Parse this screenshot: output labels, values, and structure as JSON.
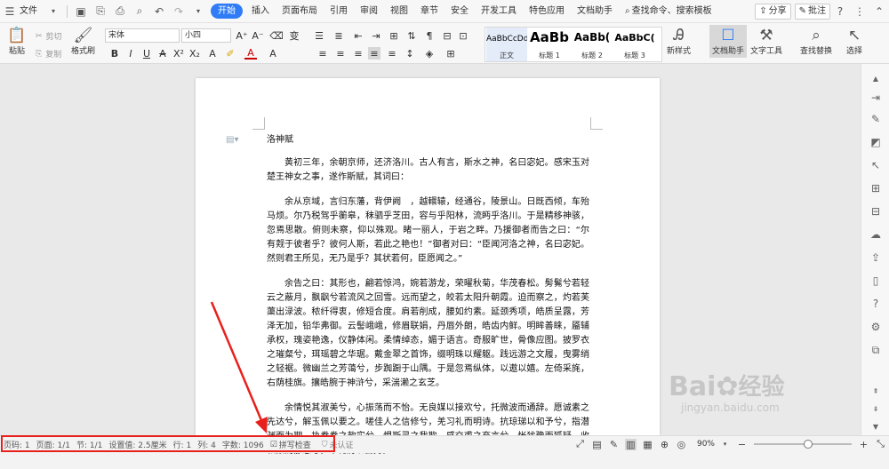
{
  "menubar": {
    "items": [
      "文件",
      "开始",
      "插入",
      "页面布局",
      "引用",
      "审阅",
      "视图",
      "章节",
      "安全",
      "开发工具",
      "特色应用",
      "文档助手"
    ],
    "active": "开始",
    "search_label": "查找命令、搜索模板",
    "share_label": "分享",
    "comment_label": "批注",
    "help_label": "?"
  },
  "ribbon": {
    "paste_label": "粘贴",
    "cut_label": "剪切",
    "copy_label": "复制",
    "format_painter_label": "格式刷",
    "font_name": "宋体",
    "font_size": "小四",
    "styles": [
      {
        "preview": "AaBbCcDd",
        "label": "正文"
      },
      {
        "preview": "AaBb",
        "label": "标题 1"
      },
      {
        "preview": "AaBb(",
        "label": "标题 2"
      },
      {
        "preview": "AaBbC(",
        "label": "标题 3"
      }
    ],
    "new_style_label": "新样式",
    "doc_assistant_label": "文档助手",
    "text_tools_label": "文字工具",
    "find_replace_label": "查找替换",
    "select_label": "选择"
  },
  "document": {
    "title": "洛神赋",
    "paragraphs": [
      "黄初三年，余朝京师，还济洛川。古人有言，斯水之神，名曰宓妃。感宋玉对楚王神女之事，遂作斯赋，其词曰：",
      "余从京域，言归东藩，背伊阙　，越轘辕，经通谷，陵景山。日既西倾，车殆马烦。尔乃税驾乎蘅皋，秣驷乎芝田，容与乎阳林，流眄乎洛川。于是精移神骇，忽焉思散。俯则未察，仰以殊观。睹一丽人，于岩之畔。乃援御者而告之曰：“尔有觌于彼者乎？彼何人斯，若此之艳也！”御者对曰：“臣闻河洛之神，名曰宓妃。然则君王所见，无乃是乎？其状若何，臣愿闻之。”",
      "余告之曰：其形也，翩若惊鸿，婉若游龙，荣曜秋菊，华茂春松。髣髴兮若轻云之蔽月，飘飖兮若流风之回雪。远而望之，皎若太阳升朝霞。迫而察之，灼若芙蕖出渌波。秾纤得衷，修短合度。肩若削成，腰如约素。延颈秀项，皓质呈露，芳泽无加，铅华弗御。云髻峨峨，修眉联娟，丹唇外朗，皓齿内鲜。明眸善睐，靥辅承权，瑰姿艳逸，仪静体闲。柔情绰态，媚于语言。奇服旷世，骨像应图。披罗衣之璀粲兮，珥瑶碧之华琚。戴金翠之首饰，缀明珠以耀躯。践远游之文履，曳雾绡之轻裾。微幽兰之芳蔼兮，步踟蹰于山隅。于是忽焉纵体，以遨以嬉。左倚采旄，右荫桂旗。攘皓腕于神浒兮，采湍濑之玄芝。",
      "余情悦其淑美兮，心振荡而不怡。无良媒以接欢兮，托微波而通辞。愿诚素之先达兮，解玉佩以要之。嗟佳人之信修兮，羌习礼而明诗。抗琼珶以和予兮，指潜渊而为期。执眷眷之款实兮，惧斯灵之我欺。感交甫之弃言兮，怅犹豫而狐疑。收和颜而静志兮，申礼防以自持。"
    ]
  },
  "status": {
    "page_code": "页码: 1",
    "pages": "页面: 1/1",
    "section": "节: 1/1",
    "setting": "设置值: 2.5厘米",
    "row": "行: 1",
    "col": "列: 4",
    "word_count": "字数: 1096",
    "spell_check": "拼写检查",
    "certify": "未认证",
    "zoom": "90%"
  },
  "watermark": {
    "brand": "Bai",
    "brand_cn": "经验",
    "url": "jingyan.baidu.com"
  },
  "colors": {
    "accent": "#2f7cf6",
    "highlight": "#e8201c"
  }
}
